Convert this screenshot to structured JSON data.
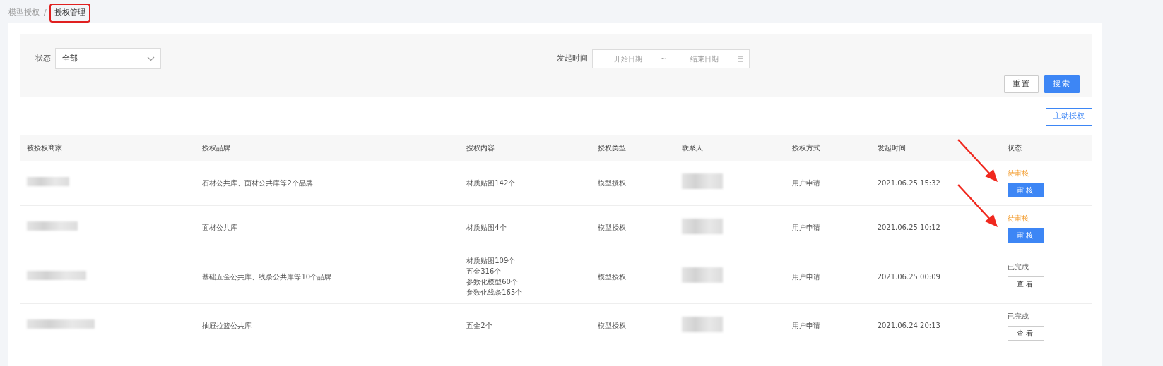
{
  "breadcrumb_separator": "/",
  "breadcrumb": [
    {
      "label": "模型授权",
      "current": false,
      "highlighted": false
    },
    {
      "label": "授权管理",
      "current": true,
      "highlighted": true
    }
  ],
  "filters": {
    "status_label": "状态",
    "status_value": "全部",
    "date_label": "发起时间",
    "start_placeholder": "开始日期",
    "separator": "~",
    "end_placeholder": "结束日期"
  },
  "buttons": {
    "reset": "重置",
    "search": "搜索",
    "grant": "主动授权"
  },
  "table": {
    "columns": [
      "被授权商家",
      "授权品牌",
      "授权内容",
      "授权类型",
      "联系人",
      "授权方式",
      "发起时间",
      "状态"
    ],
    "rows": [
      {
        "merchant_redacted": true,
        "brand": "石材公共库、面材公共库等2个品牌",
        "content": [
          "材质贴图142个"
        ],
        "type": "模型授权",
        "contact_redacted": true,
        "method": "用户申请",
        "time": "2021.06.25 15:32",
        "status": "待审核",
        "pending": true,
        "action": "审核",
        "arrow": true
      },
      {
        "merchant_redacted": true,
        "brand": "面材公共库",
        "content": [
          "材质贴图4个"
        ],
        "type": "模型授权",
        "contact_redacted": true,
        "method": "用户申请",
        "time": "2021.06.25 10:12",
        "status": "待审核",
        "pending": true,
        "action": "审核",
        "arrow": true
      },
      {
        "merchant_redacted": true,
        "brand": "基础五金公共库、线条公共库等10个品牌",
        "content": [
          "材质贴图109个",
          "五金316个",
          "参数化模型60个",
          "参数化线条165个"
        ],
        "type": "模型授权",
        "contact_redacted": true,
        "method": "用户申请",
        "time": "2021.06.25 00:09",
        "status": "已完成",
        "pending": false,
        "action": "查看",
        "arrow": false
      },
      {
        "merchant_redacted": true,
        "brand": "抽屉拉篮公共库",
        "content": [
          "五金2个"
        ],
        "type": "模型授权",
        "contact_redacted": true,
        "method": "用户申请",
        "time": "2021.06.24 20:13",
        "status": "已完成",
        "pending": false,
        "action": "查看",
        "arrow": false
      }
    ]
  }
}
